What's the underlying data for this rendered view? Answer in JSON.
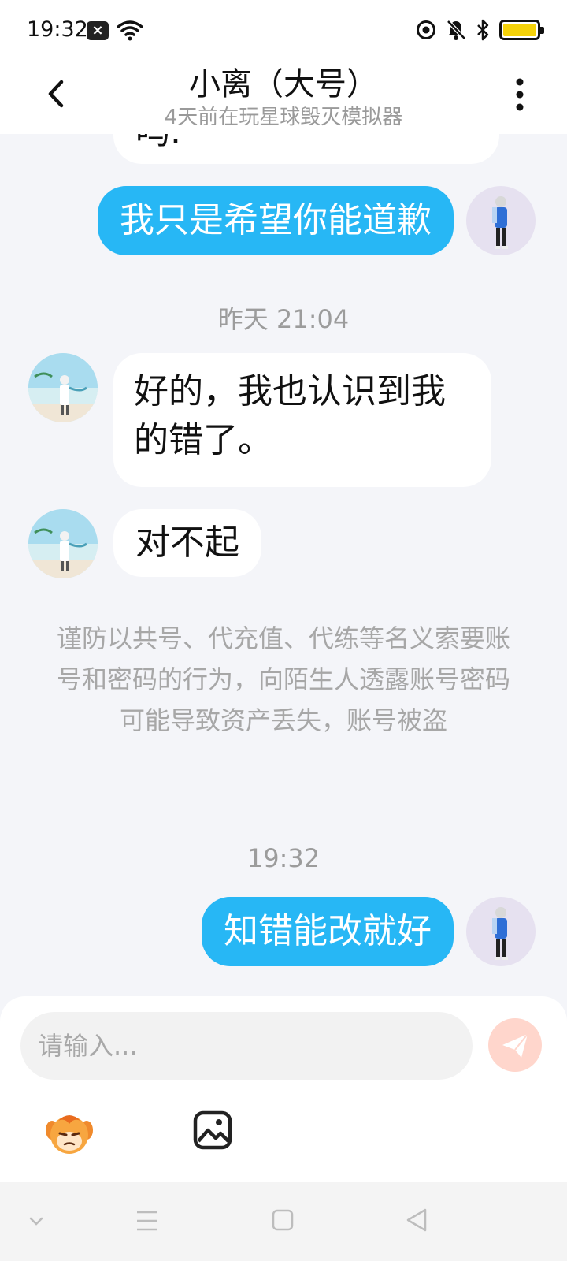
{
  "status_bar": {
    "time": "19:32",
    "icons": [
      "notification-x-icon",
      "wifi-icon",
      "focus-mode-icon",
      "silent-bell-icon",
      "bluetooth-icon",
      "battery-icon"
    ],
    "battery_color": "#f5d20a"
  },
  "header": {
    "title": "小离（大号）",
    "subtitle": "4天前在玩星球毁灭模拟器"
  },
  "colors": {
    "accent": "#27b7f5",
    "background": "#f4f5f9",
    "send_button": "#ffd6cc"
  },
  "messages": [
    {
      "direction": "in",
      "text": "吗."
    },
    {
      "direction": "out",
      "text": "我只是希望你能道歉"
    },
    {
      "type": "timestamp",
      "text": "昨天 21:04"
    },
    {
      "direction": "in",
      "text": "好的，我也认识到我的错了。"
    },
    {
      "direction": "in",
      "text": "对不起"
    },
    {
      "type": "notice",
      "text": "谨防以共号、代充值、代练等名义索要账号和密码的行为，向陌生人透露账号密码可能导致资产丢失，账号被盗"
    },
    {
      "type": "timestamp",
      "text": "19:32"
    },
    {
      "direction": "out",
      "text": "知错能改就好"
    }
  ],
  "input": {
    "placeholder": "请输入..."
  },
  "toolbar": [
    "emoji-icon",
    "image-icon"
  ],
  "nav_bar": [
    "collapse-chevron-icon",
    "menu-icon",
    "home-icon",
    "back-triangle-icon"
  ]
}
